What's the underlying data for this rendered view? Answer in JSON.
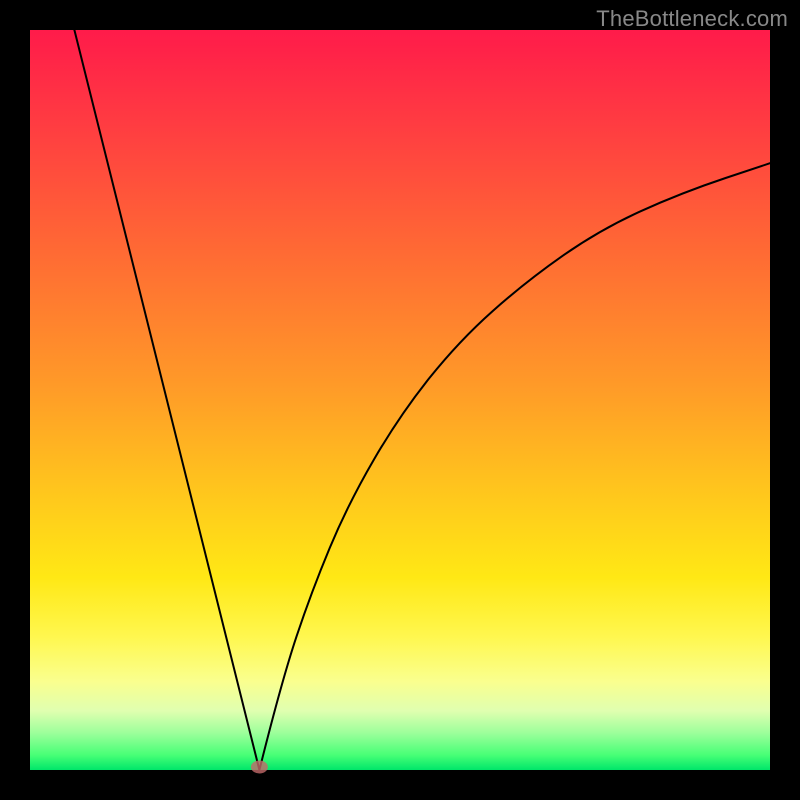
{
  "watermark": "TheBottleneck.com",
  "chart_data": {
    "type": "line",
    "title": "",
    "xlabel": "",
    "ylabel": "",
    "description": "V-shaped curve on a red-to-green vertical gradient background; minimum near x≈0.31. Left branch nearly straight, right branch concave approaching an asymptote near y≈0.82.",
    "xlim": [
      0,
      1
    ],
    "ylim": [
      0,
      1
    ],
    "min_point": {
      "x": 0.31,
      "y": 0.0
    },
    "left_branch": {
      "start": {
        "x": 0.06,
        "y": 1.0
      },
      "end": {
        "x": 0.31,
        "y": 0.0
      }
    },
    "right_branch_samples": [
      {
        "x": 0.31,
        "y": 0.0
      },
      {
        "x": 0.34,
        "y": 0.12
      },
      {
        "x": 0.38,
        "y": 0.24
      },
      {
        "x": 0.43,
        "y": 0.36
      },
      {
        "x": 0.5,
        "y": 0.48
      },
      {
        "x": 0.58,
        "y": 0.58
      },
      {
        "x": 0.67,
        "y": 0.66
      },
      {
        "x": 0.77,
        "y": 0.73
      },
      {
        "x": 0.88,
        "y": 0.78
      },
      {
        "x": 1.0,
        "y": 0.82
      }
    ]
  },
  "colors": {
    "bg_top": "#ff1b4a",
    "bg_bottom": "#00e66a",
    "frame": "#000000",
    "curve": "#000000",
    "dot": "#c46b6b"
  }
}
